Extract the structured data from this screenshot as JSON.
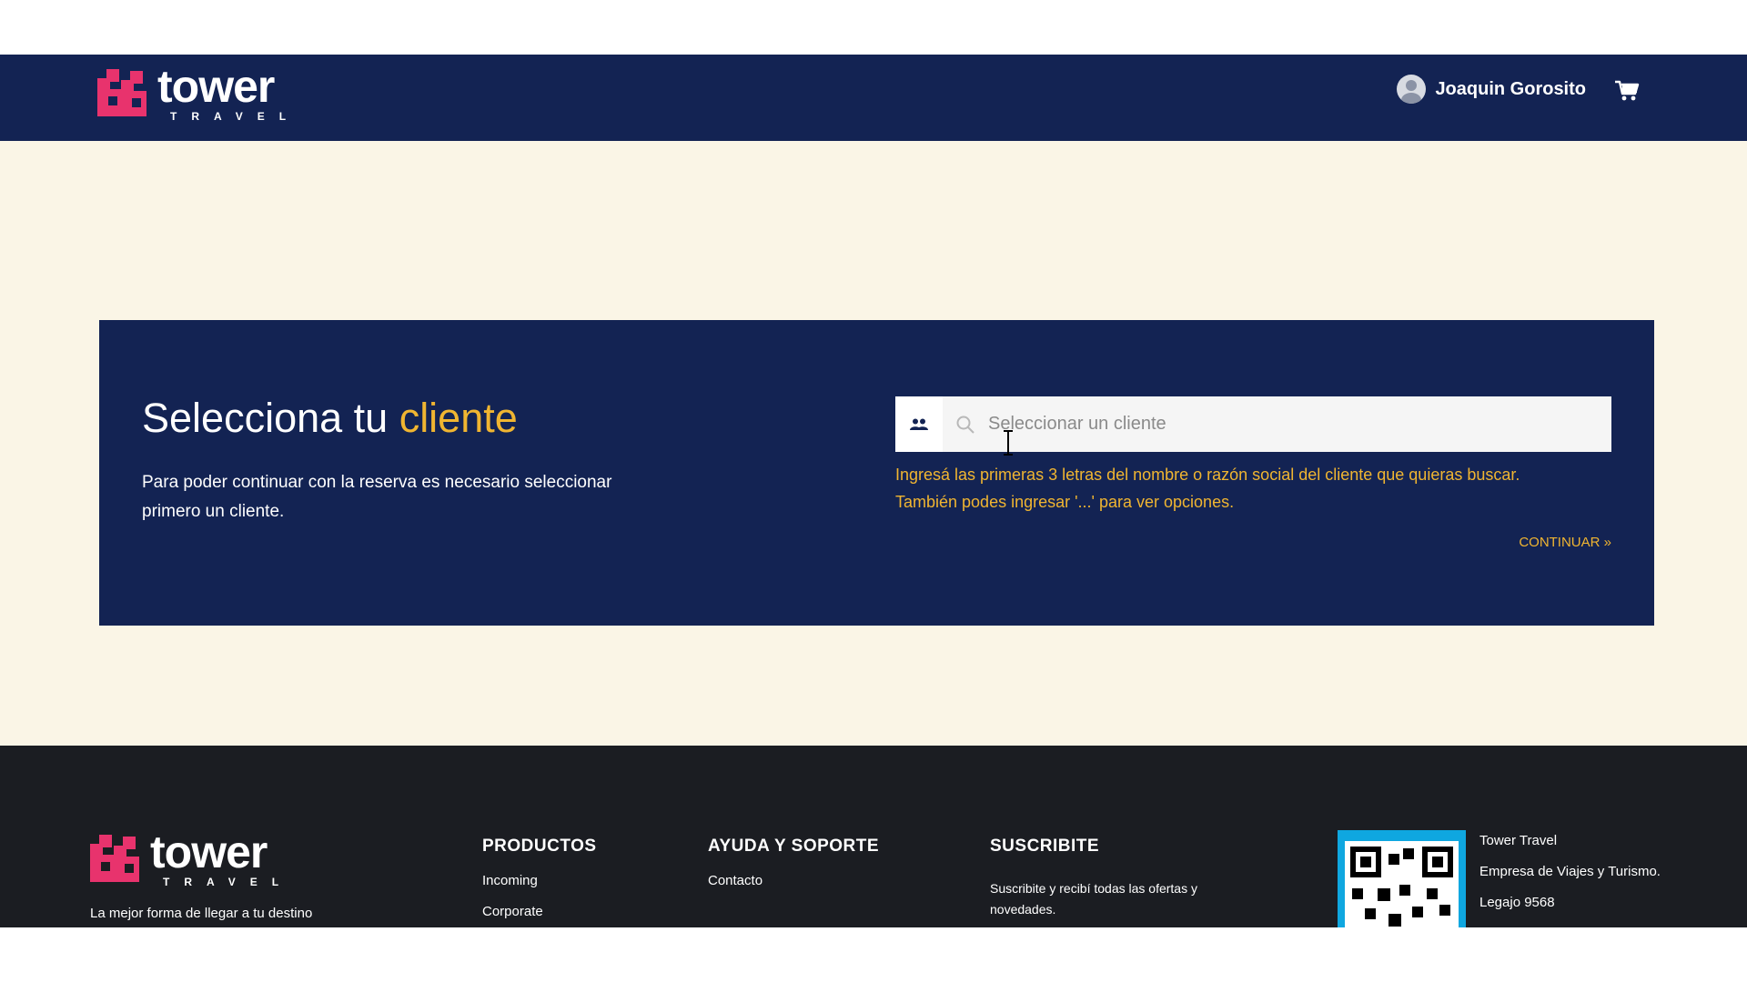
{
  "header": {
    "logo_word": "tower",
    "logo_sub": "TRAVEL",
    "user_name": "Joaquin Gorosito"
  },
  "main": {
    "title_prefix": "Selecciona tu ",
    "title_accent": "cliente",
    "description": "Para poder continuar con la reserva es necesario seleccionar primero un cliente.",
    "select_placeholder": "Seleccionar un cliente",
    "hint_line1": "Ingresá las primeras 3 letras del nombre o razón social del cliente que quieras buscar.",
    "hint_line2": "También podes ingresar '...' para ver opciones.",
    "continue_label": "CONTINUAR »"
  },
  "footer": {
    "logo_word": "tower",
    "logo_sub": "TRAVEL",
    "tagline": "La mejor forma de llegar a tu destino",
    "productos_title": "PRODUCTOS",
    "productos_items": [
      "Incoming",
      "Corporate"
    ],
    "ayuda_title": "AYUDA Y SOPORTE",
    "ayuda_items": [
      "Contacto"
    ],
    "suscribite_title": "SUSCRIBITE",
    "suscribite_text": "Suscribite y recibí todas las ofertas y novedades.",
    "company_name": "Tower Travel",
    "company_desc": "Empresa de Viajes y Turismo.",
    "company_legajo": "Legajo 9568"
  },
  "colors": {
    "navy": "#132353",
    "accent": "#f0b531",
    "brand_pink": "#e8336d",
    "cream": "#faf5e6",
    "footer_bg": "#1b1d22",
    "qr_border": "#0fa7e0"
  }
}
